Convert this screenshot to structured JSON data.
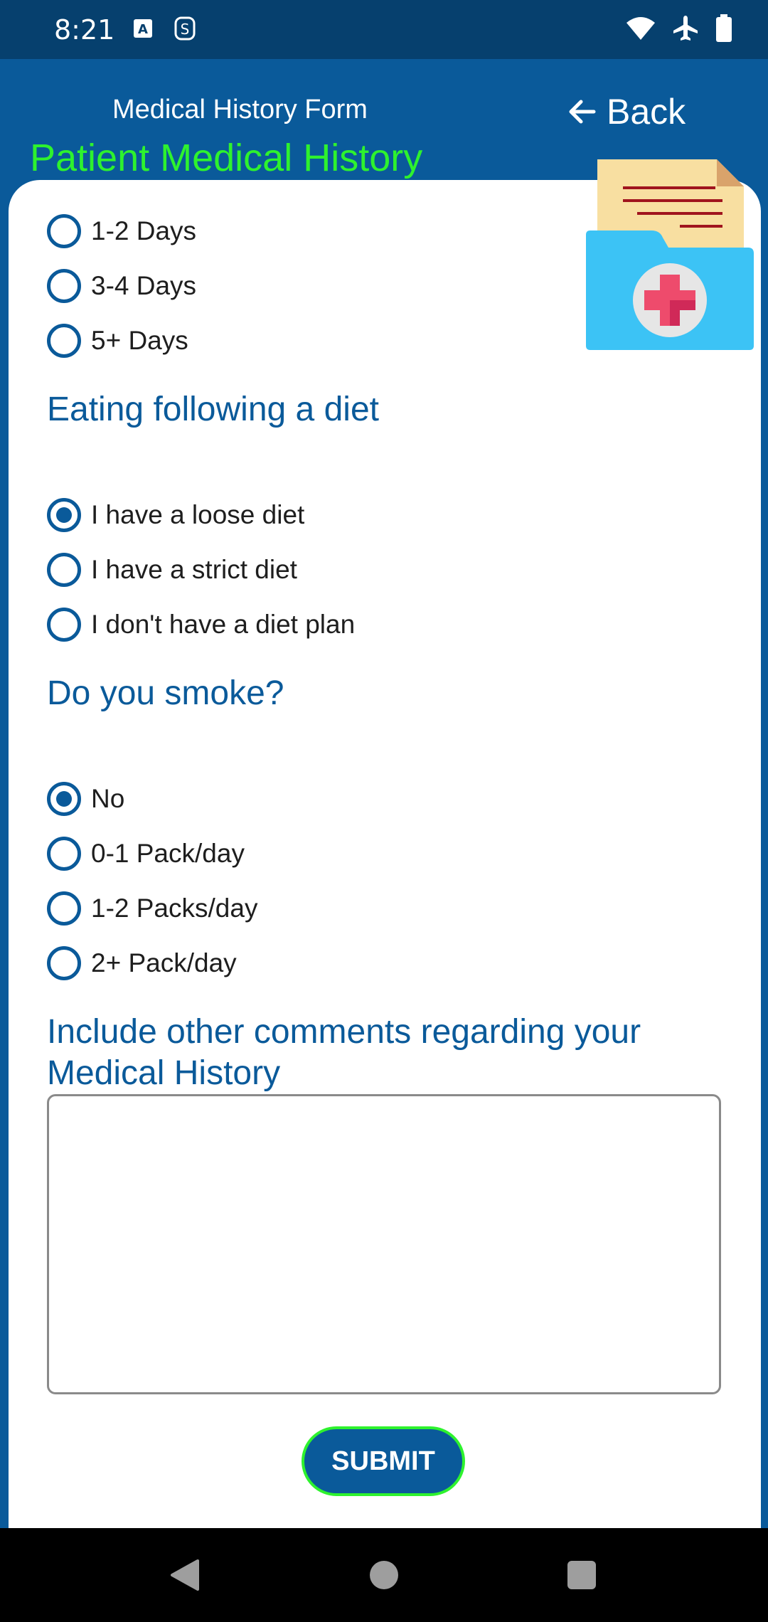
{
  "status_bar": {
    "time": "8:21",
    "left_icons": [
      "keyboard-a-icon",
      "smiley-s-icon"
    ],
    "right_icons": [
      "wifi-icon",
      "airplane-icon",
      "battery-icon"
    ]
  },
  "header": {
    "title": "Medical History Form",
    "back_label": "Back",
    "page_title": "Patient Medical History"
  },
  "exercise": {
    "options": [
      {
        "label": "1-2 Days",
        "selected": false
      },
      {
        "label": "3-4 Days",
        "selected": false
      },
      {
        "label": "5+ Days",
        "selected": false
      }
    ]
  },
  "diet": {
    "heading": "Eating following a diet",
    "options": [
      {
        "label": "I have a loose diet",
        "selected": true
      },
      {
        "label": "I have a strict diet",
        "selected": false
      },
      {
        "label": "I don't have a diet plan",
        "selected": false
      }
    ]
  },
  "smoke": {
    "heading": "Do you smoke?",
    "options": [
      {
        "label": "No",
        "selected": true
      },
      {
        "label": "0-1 Pack/day",
        "selected": false
      },
      {
        "label": "1-2 Packs/day",
        "selected": false
      },
      {
        "label": "2+ Pack/day",
        "selected": false
      }
    ]
  },
  "comments": {
    "heading_line1": "Include other comments regarding your",
    "heading_line2": "Medical History",
    "value": ""
  },
  "submit_label": "SUBMIT",
  "colors": {
    "primary": "#0a5a9a",
    "accent_green": "#2ef22e",
    "status_bar": "#06406e"
  }
}
